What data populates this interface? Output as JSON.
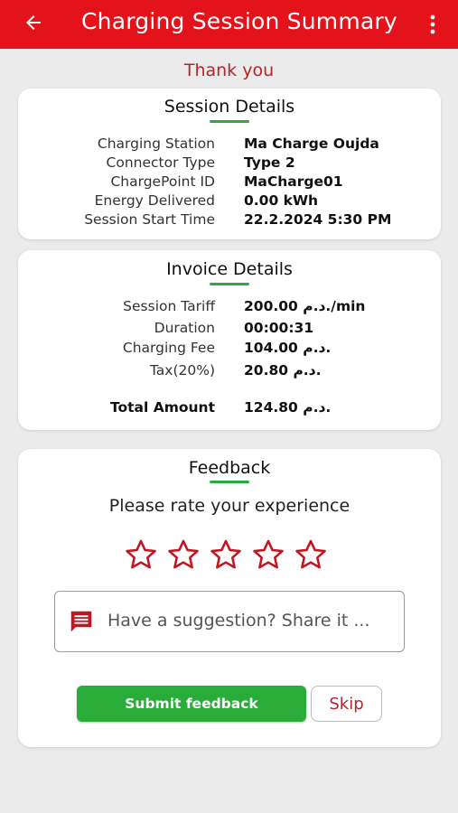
{
  "header": {
    "title": "Charging Session Summary",
    "back_icon": "arrow-left-icon",
    "menu_icon": "more-vertical-icon",
    "color": "#e3121b"
  },
  "thanks": "Thank you",
  "session": {
    "title": "Session Details",
    "rows": [
      {
        "label": "Charging Station",
        "value": "Ma Charge Oujda"
      },
      {
        "label": "Connector Type",
        "value": "Type 2"
      },
      {
        "label": "ChargePoint ID",
        "value": "MaCharge01"
      },
      {
        "label": "Energy Delivered",
        "value": "0.00 kWh"
      },
      {
        "label": "Session Start Time",
        "value": "22.2.2024 5:30 PM"
      }
    ]
  },
  "invoice": {
    "title": "Invoice Details",
    "rows": [
      {
        "label": "Session Tariff",
        "value": "200.00 د.م./min"
      },
      {
        "label": "Duration",
        "value": "00:00:31"
      },
      {
        "label": "Charging Fee",
        "value": "104.00 د.م."
      },
      {
        "label": "Tax(20%)",
        "value": "20.80 د.م."
      }
    ],
    "total": {
      "label": "Total Amount",
      "value": "124.80 د.م."
    }
  },
  "feedback": {
    "title": "Feedback",
    "prompt": "Please rate your experience",
    "rating": 0,
    "max_rating": 5,
    "suggestion_placeholder": "Have a suggestion? Share it ...",
    "submit_label": "Submit feedback",
    "skip_label": "Skip",
    "accent": "#2aac3b",
    "star_color": "#c0161f"
  }
}
